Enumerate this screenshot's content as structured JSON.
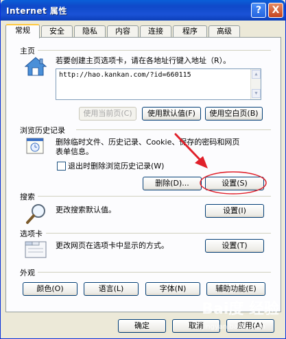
{
  "window": {
    "title": "Internet 属性",
    "help_glyph": "?",
    "close_glyph": "X"
  },
  "tabs": [
    "常规",
    "安全",
    "隐私",
    "内容",
    "连接",
    "程序",
    "高级"
  ],
  "home": {
    "group_title": "主页",
    "description": "若要创建主页选项卡，请在各地址行键入地址（R）。",
    "url": "http://hao.kankan.com/?id=660115",
    "btn_current": "使用当前页(C)",
    "btn_default": "使用默认值(F)",
    "btn_blank": "使用空白页(B)"
  },
  "history": {
    "group_title": "浏览历史记录",
    "description_line1": "删除临时文件、历史记录、Cookie、保存的密码和网页",
    "description_line2": "表单信息。",
    "checkbox_label": "退出时删除浏览历史记录(W)",
    "btn_delete": "删除(D)...",
    "btn_settings": "设置(S)"
  },
  "search": {
    "group_title": "搜索",
    "description": "更改搜索默认值。",
    "btn_settings": "设置(I)"
  },
  "tabs_section": {
    "group_title": "选项卡",
    "description": "更改网页在选项卡中显示的方式。",
    "btn_settings": "设置(T)"
  },
  "appearance": {
    "group_title": "外观",
    "btn_colors": "颜色(O)",
    "btn_languages": "语言(L)",
    "btn_fonts": "字体(N)",
    "btn_accessibility": "辅助功能(E)"
  },
  "footer": {
    "btn_ok": "确定",
    "btn_cancel": "取消",
    "btn_apply": "应用(A)"
  },
  "watermark": {
    "logo": "Bai度 经验",
    "url": "jingyan.baidu.com"
  },
  "colors": {
    "title_bar": "#0f49c9",
    "annotation": "#e0202a",
    "dialog_bg": "#ece9d8"
  }
}
